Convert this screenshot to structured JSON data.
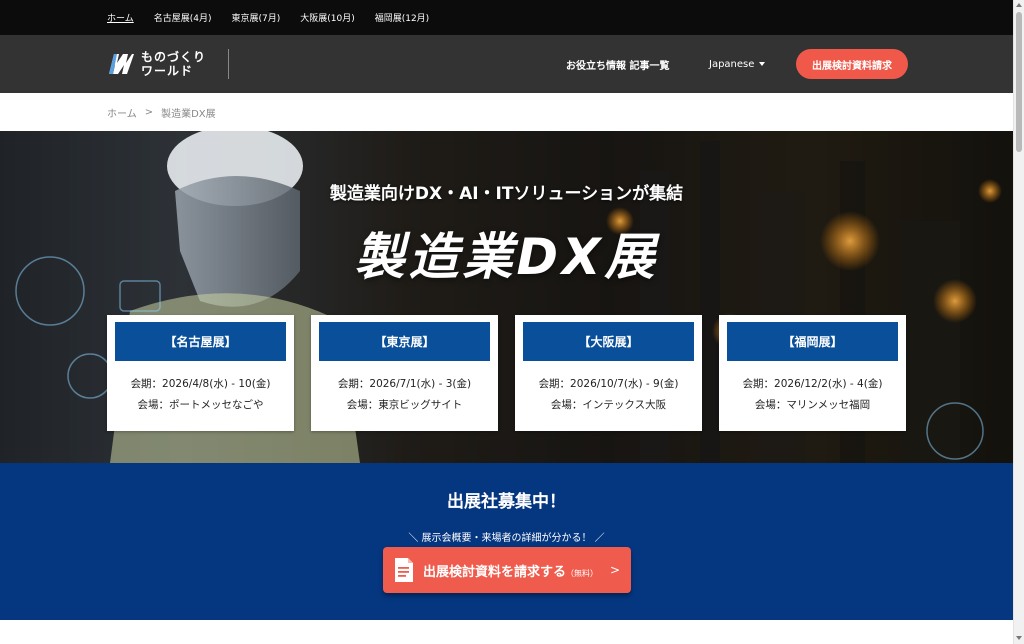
{
  "topbar": {
    "links": [
      "ホーム",
      "名古屋展(4月)",
      "東京展(7月)",
      "大阪展(10月)",
      "福岡展(12月)"
    ]
  },
  "header": {
    "logo_line1": "ものづくり",
    "logo_line2": "ワールド",
    "articles": "お役立ち情報 記事一覧",
    "language": "Japanese",
    "cta": "出展検討資料請求"
  },
  "breadcrumb": {
    "home": "ホーム",
    "sep": ">",
    "current": "製造業DX展"
  },
  "hero": {
    "subtitle": "製造業向けDX・AI・ITソリューションが集結",
    "title": "製造業DX展",
    "cards": [
      {
        "name": "【名古屋展】",
        "period": "会期：2026/4/8(水) - 10(金)",
        "venue": "会場：ポートメッセなごや"
      },
      {
        "name": "【東京展】",
        "period": "会期：2026/7/1(水) - 3(金)",
        "venue": "会場：東京ビッグサイト"
      },
      {
        "name": "【大阪展】",
        "period": "会期：2026/10/7(水) - 9(金)",
        "venue": "会場：インテックス大阪"
      },
      {
        "name": "【福岡展】",
        "period": "会期：2026/12/2(水) - 4(金)",
        "venue": "会場：マリンメッセ福岡"
      }
    ]
  },
  "recruit": {
    "title": "出展社募集中！",
    "subtitle": "＼ 展示会概要・来場者の詳細が分かる！ ／",
    "button_main": "出展検討資料を請求する",
    "button_small": "（無料）",
    "button_arrow": ">"
  },
  "colors": {
    "topbar": "#0c0c0c",
    "header": "#333333",
    "cta": "#f0584a",
    "card_head": "#0a4f9a",
    "recruit_bg": "#053680"
  }
}
